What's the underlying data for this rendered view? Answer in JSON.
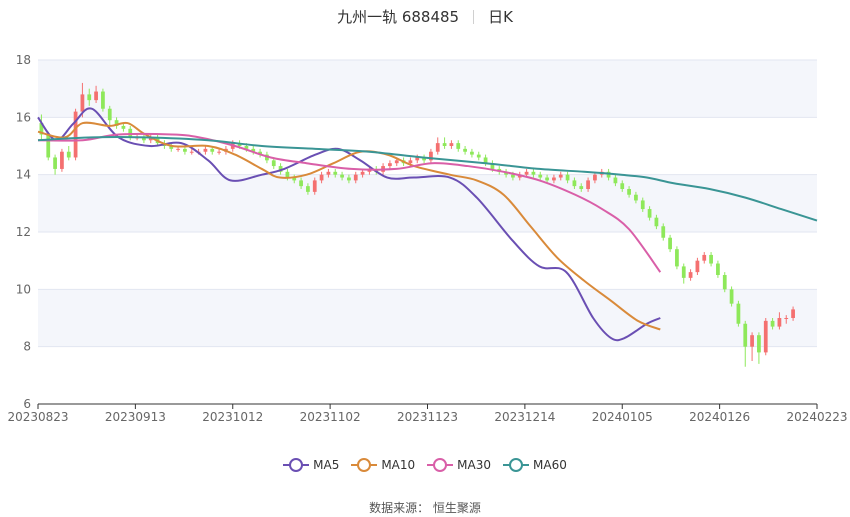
{
  "header": {
    "stock": "九州一轨 688485",
    "period": "日K"
  },
  "source": "数据来源： 恒生聚源",
  "chart_data": {
    "type": "candlestick",
    "ylim": [
      6,
      18
    ],
    "yticks": [
      6,
      8,
      10,
      12,
      14,
      16,
      18
    ],
    "xticks": [
      "20230823",
      "20230913",
      "20231012",
      "20231102",
      "20231123",
      "20231214",
      "20240105",
      "20240126",
      "20240223"
    ],
    "colors": {
      "up": "#f47070",
      "down": "#8ee85a"
    },
    "ohlc": [
      [
        15.8,
        15.4,
        16.1,
        15.2
      ],
      [
        15.4,
        14.6,
        15.5,
        14.5
      ],
      [
        14.6,
        14.2,
        14.7,
        14.0
      ],
      [
        14.2,
        14.8,
        14.9,
        14.1
      ],
      [
        14.8,
        14.6,
        15.0,
        14.5
      ],
      [
        14.6,
        16.2,
        16.3,
        14.5
      ],
      [
        16.2,
        16.8,
        17.2,
        16.0
      ],
      [
        16.8,
        16.6,
        17.0,
        16.4
      ],
      [
        16.6,
        16.9,
        17.1,
        16.5
      ],
      [
        16.9,
        16.3,
        17.0,
        16.2
      ],
      [
        16.3,
        15.9,
        16.4,
        15.7
      ],
      [
        15.9,
        15.7,
        16.0,
        15.6
      ],
      [
        15.7,
        15.6,
        15.8,
        15.5
      ],
      [
        15.6,
        15.3,
        15.7,
        15.2
      ],
      [
        15.3,
        15.3,
        15.4,
        15.2
      ],
      [
        15.3,
        15.2,
        15.4,
        15.1
      ],
      [
        15.2,
        15.3,
        15.4,
        15.1
      ],
      [
        15.3,
        15.1,
        15.4,
        15.0
      ],
      [
        15.1,
        15.0,
        15.2,
        14.9
      ],
      [
        15.0,
        14.9,
        15.1,
        14.8
      ],
      [
        14.9,
        14.9,
        15.0,
        14.8
      ],
      [
        14.9,
        14.8,
        15.0,
        14.7
      ],
      [
        14.8,
        14.8,
        14.9,
        14.7
      ],
      [
        14.8,
        14.8,
        14.9,
        14.7
      ],
      [
        14.8,
        14.9,
        15.0,
        14.7
      ],
      [
        14.9,
        14.8,
        15.0,
        14.7
      ],
      [
        14.8,
        14.8,
        14.9,
        14.7
      ],
      [
        14.8,
        14.9,
        15.0,
        14.7
      ],
      [
        14.9,
        15.1,
        15.2,
        14.8
      ],
      [
        15.1,
        15.0,
        15.2,
        14.9
      ],
      [
        15.0,
        14.9,
        15.1,
        14.8
      ],
      [
        14.9,
        14.8,
        15.0,
        14.7
      ],
      [
        14.8,
        14.7,
        14.9,
        14.6
      ],
      [
        14.7,
        14.5,
        14.8,
        14.4
      ],
      [
        14.5,
        14.3,
        14.6,
        14.2
      ],
      [
        14.3,
        14.1,
        14.4,
        14.0
      ],
      [
        14.1,
        13.9,
        14.2,
        13.8
      ],
      [
        13.9,
        13.8,
        14.0,
        13.7
      ],
      [
        13.8,
        13.6,
        13.9,
        13.5
      ],
      [
        13.6,
        13.4,
        13.7,
        13.3
      ],
      [
        13.4,
        13.8,
        13.9,
        13.3
      ],
      [
        13.8,
        14.0,
        14.1,
        13.7
      ],
      [
        14.0,
        14.1,
        14.2,
        13.9
      ],
      [
        14.1,
        14.0,
        14.2,
        13.9
      ],
      [
        14.0,
        13.9,
        14.1,
        13.8
      ],
      [
        13.9,
        13.8,
        14.0,
        13.7
      ],
      [
        13.8,
        14.0,
        14.1,
        13.7
      ],
      [
        14.0,
        14.1,
        14.2,
        13.9
      ],
      [
        14.1,
        14.2,
        14.3,
        14.0
      ],
      [
        14.2,
        14.1,
        14.3,
        14.0
      ],
      [
        14.1,
        14.3,
        14.4,
        14.0
      ],
      [
        14.3,
        14.4,
        14.5,
        14.2
      ],
      [
        14.4,
        14.5,
        14.6,
        14.3
      ],
      [
        14.5,
        14.4,
        14.6,
        14.3
      ],
      [
        14.4,
        14.5,
        14.6,
        14.3
      ],
      [
        14.5,
        14.6,
        14.7,
        14.4
      ],
      [
        14.6,
        14.5,
        14.7,
        14.4
      ],
      [
        14.5,
        14.8,
        14.9,
        14.4
      ],
      [
        14.8,
        15.1,
        15.3,
        14.7
      ],
      [
        15.1,
        15.0,
        15.3,
        14.9
      ],
      [
        15.0,
        15.1,
        15.2,
        14.9
      ],
      [
        15.1,
        14.9,
        15.2,
        14.8
      ],
      [
        14.9,
        14.8,
        15.0,
        14.7
      ],
      [
        14.8,
        14.7,
        14.9,
        14.6
      ],
      [
        14.7,
        14.6,
        14.8,
        14.5
      ],
      [
        14.6,
        14.4,
        14.7,
        14.3
      ],
      [
        14.4,
        14.2,
        14.5,
        14.1
      ],
      [
        14.2,
        14.1,
        14.3,
        14.0
      ],
      [
        14.1,
        14.0,
        14.2,
        13.9
      ],
      [
        14.0,
        13.9,
        14.1,
        13.8
      ],
      [
        13.9,
        14.0,
        14.1,
        13.8
      ],
      [
        14.0,
        14.1,
        14.2,
        13.9
      ],
      [
        14.1,
        14.0,
        14.2,
        13.9
      ],
      [
        14.0,
        13.9,
        14.1,
        13.8
      ],
      [
        13.9,
        13.8,
        14.0,
        13.7
      ],
      [
        13.8,
        13.9,
        14.0,
        13.7
      ],
      [
        13.9,
        14.0,
        14.1,
        13.8
      ],
      [
        14.0,
        13.8,
        14.1,
        13.7
      ],
      [
        13.8,
        13.6,
        13.9,
        13.5
      ],
      [
        13.6,
        13.5,
        13.7,
        13.4
      ],
      [
        13.5,
        13.8,
        13.9,
        13.4
      ],
      [
        13.8,
        14.0,
        14.1,
        13.7
      ],
      [
        14.0,
        14.1,
        14.2,
        13.9
      ],
      [
        14.1,
        13.9,
        14.2,
        13.8
      ],
      [
        13.9,
        13.7,
        14.0,
        13.6
      ],
      [
        13.7,
        13.5,
        13.8,
        13.4
      ],
      [
        13.5,
        13.3,
        13.6,
        13.2
      ],
      [
        13.3,
        13.1,
        13.4,
        13.0
      ],
      [
        13.1,
        12.8,
        13.2,
        12.7
      ],
      [
        12.8,
        12.5,
        12.9,
        12.4
      ],
      [
        12.5,
        12.2,
        12.6,
        12.1
      ],
      [
        12.2,
        11.8,
        12.3,
        11.7
      ],
      [
        11.8,
        11.4,
        11.9,
        11.3
      ],
      [
        11.4,
        10.8,
        11.5,
        10.7
      ],
      [
        10.8,
        10.4,
        10.9,
        10.2
      ],
      [
        10.4,
        10.6,
        10.7,
        10.3
      ],
      [
        10.6,
        11.0,
        11.1,
        10.5
      ],
      [
        11.0,
        11.2,
        11.3,
        10.9
      ],
      [
        11.2,
        10.9,
        11.3,
        10.8
      ],
      [
        10.9,
        10.5,
        11.0,
        10.4
      ],
      [
        10.5,
        10.0,
        10.6,
        9.9
      ],
      [
        10.0,
        9.5,
        10.1,
        9.4
      ],
      [
        9.5,
        8.8,
        9.6,
        8.7
      ],
      [
        8.8,
        8.0,
        8.9,
        7.3
      ],
      [
        8.0,
        8.4,
        8.5,
        7.5
      ],
      [
        8.4,
        7.8,
        8.5,
        7.4
      ],
      [
        7.8,
        8.9,
        9.0,
        7.7
      ],
      [
        8.9,
        8.7,
        9.0,
        8.6
      ],
      [
        8.7,
        9.0,
        9.2,
        8.6
      ],
      [
        9.0,
        9.0,
        9.1,
        8.8
      ],
      [
        9.0,
        9.3,
        9.4,
        8.9
      ]
    ],
    "series": [
      {
        "name": "MA5",
        "color": "#6a4fb3",
        "values": [
          [
            0,
            16.0
          ],
          [
            4,
            15.2
          ],
          [
            8,
            15.8
          ],
          [
            12,
            16.3
          ],
          [
            18,
            15.3
          ],
          [
            25,
            15.0
          ],
          [
            32,
            15.1
          ],
          [
            38,
            14.5
          ],
          [
            43,
            13.8
          ],
          [
            50,
            14.0
          ],
          [
            55,
            14.2
          ],
          [
            62,
            14.7
          ],
          [
            67,
            14.9
          ],
          [
            72,
            14.5
          ],
          [
            78,
            13.9
          ],
          [
            84,
            13.9
          ],
          [
            92,
            13.9
          ],
          [
            98,
            13.2
          ],
          [
            106,
            11.7
          ],
          [
            112,
            10.8
          ],
          [
            118,
            10.6
          ],
          [
            124,
            9.0
          ],
          [
            128,
            8.3
          ],
          [
            131,
            8.3
          ],
          [
            136,
            8.8
          ],
          [
            139,
            9.0
          ]
        ]
      },
      {
        "name": "MA10",
        "color": "#d98a3a",
        "values": [
          [
            0,
            15.5
          ],
          [
            6,
            15.3
          ],
          [
            10,
            15.8
          ],
          [
            16,
            15.7
          ],
          [
            20,
            15.8
          ],
          [
            24,
            15.4
          ],
          [
            30,
            15.0
          ],
          [
            38,
            15.0
          ],
          [
            44,
            14.7
          ],
          [
            50,
            14.2
          ],
          [
            54,
            13.9
          ],
          [
            60,
            14.0
          ],
          [
            66,
            14.4
          ],
          [
            72,
            14.8
          ],
          [
            78,
            14.7
          ],
          [
            84,
            14.3
          ],
          [
            92,
            14.0
          ],
          [
            98,
            13.8
          ],
          [
            104,
            13.3
          ],
          [
            110,
            12.2
          ],
          [
            116,
            11.1
          ],
          [
            122,
            10.3
          ],
          [
            128,
            9.6
          ],
          [
            134,
            8.9
          ],
          [
            139,
            8.6
          ]
        ]
      },
      {
        "name": "MA30",
        "color": "#d95fa8",
        "values": [
          [
            0,
            15.2
          ],
          [
            10,
            15.2
          ],
          [
            18,
            15.4
          ],
          [
            30,
            15.4
          ],
          [
            36,
            15.3
          ],
          [
            44,
            15.0
          ],
          [
            52,
            14.6
          ],
          [
            60,
            14.4
          ],
          [
            70,
            14.2
          ],
          [
            80,
            14.2
          ],
          [
            88,
            14.4
          ],
          [
            96,
            14.3
          ],
          [
            104,
            14.1
          ],
          [
            112,
            13.8
          ],
          [
            120,
            13.3
          ],
          [
            126,
            12.8
          ],
          [
            132,
            12.1
          ],
          [
            139,
            10.6
          ]
        ]
      },
      {
        "name": "MA60",
        "color": "#3a9595",
        "values": [
          [
            0,
            15.2
          ],
          [
            12,
            15.3
          ],
          [
            24,
            15.3
          ],
          [
            38,
            15.2
          ],
          [
            50,
            15.0
          ],
          [
            62,
            14.9
          ],
          [
            74,
            14.8
          ],
          [
            86,
            14.6
          ],
          [
            100,
            14.4
          ],
          [
            112,
            14.2
          ],
          [
            122,
            14.1
          ],
          [
            130,
            14.0
          ],
          [
            136,
            13.9
          ],
          [
            142,
            13.7
          ],
          [
            150,
            13.5
          ],
          [
            158,
            13.2
          ],
          [
            166,
            12.8
          ],
          [
            174,
            12.4
          ]
        ]
      }
    ]
  }
}
